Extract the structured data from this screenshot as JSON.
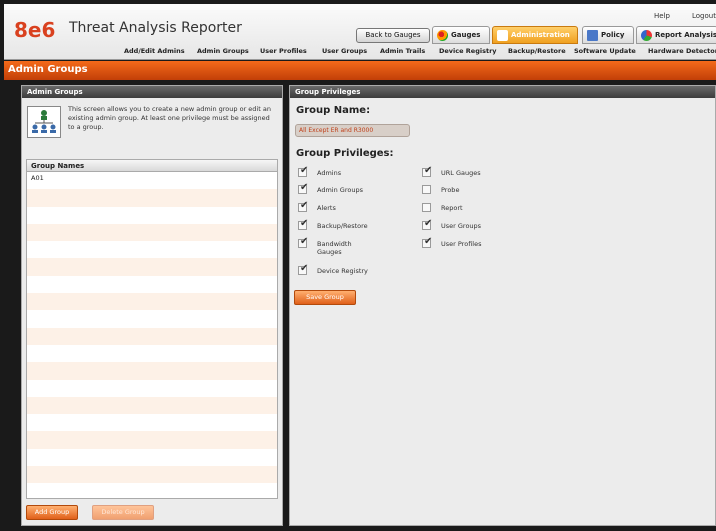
{
  "header": {
    "logo": "8e6",
    "app_title": "Threat Analysis Reporter",
    "help": "Help",
    "logout": "Logout",
    "back_to_gauges": "Back to Gauges",
    "tabs": [
      {
        "label": "Gauges",
        "icon": "gauges-icon"
      },
      {
        "label": "Administration",
        "icon": "administration-icon",
        "active": true
      },
      {
        "label": "Policy",
        "icon": "policy-icon"
      },
      {
        "label": "Report Analysis",
        "icon": "report-analysis-icon"
      }
    ],
    "subnav": [
      "Add/Edit Admins",
      "Admin Groups",
      "User Profiles",
      "User Groups",
      "Admin Trails",
      "Device Registry",
      "Backup/Restore",
      "Software Update",
      "Hardware Detector"
    ]
  },
  "page_title": "Admin Groups",
  "left_panel": {
    "title": "Admin Groups",
    "info_text": "This screen allows you to create a new admin group or edit an existing admin group.  At least one privilege must be assigned to a group.",
    "grid_header": "Group Names",
    "rows": [
      "A01",
      "",
      "",
      "",
      "",
      "",
      "",
      "",
      "",
      "",
      "",
      "",
      "",
      "",
      "",
      "",
      "",
      "",
      ""
    ],
    "add_group": "Add Group",
    "delete_group": "Delete Group"
  },
  "right_panel": {
    "title": "Group Privileges",
    "group_name_label": "Group Name:",
    "group_name_value": "All Except ER and R3000",
    "privileges_label": "Group Privileges:",
    "privileges_left": [
      {
        "label": "Admins",
        "checked": true
      },
      {
        "label": "Admin Groups",
        "checked": true
      },
      {
        "label": "Alerts",
        "checked": true
      },
      {
        "label": "Backup/Restore",
        "checked": true
      },
      {
        "label": "Bandwidth\nGauges",
        "checked": true
      },
      {
        "label": "Device Registry",
        "checked": true
      }
    ],
    "privileges_right": [
      {
        "label": "URL Gauges",
        "checked": true
      },
      {
        "label": "Probe",
        "checked": false
      },
      {
        "label": "Report",
        "checked": false
      },
      {
        "label": "User Groups",
        "checked": true
      },
      {
        "label": "User Profiles",
        "checked": true
      }
    ],
    "save_group": "Save Group"
  },
  "colors": {
    "accent": "#e0601a",
    "title_bar": "#d9521a",
    "logo": "#d9411f"
  }
}
